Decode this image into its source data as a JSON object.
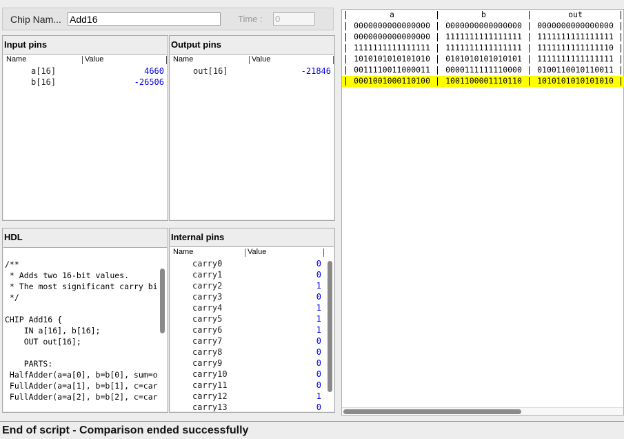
{
  "chip_bar": {
    "chip_label": "Chip Nam...",
    "chip_name": "Add16",
    "time_label": "Time :",
    "time_value": "0"
  },
  "input_pins": {
    "title": "Input pins",
    "col_name": "Name",
    "col_value": "Value",
    "rows": [
      {
        "name": "a[16]",
        "value": "4660"
      },
      {
        "name": "b[16]",
        "value": "-26506"
      }
    ]
  },
  "output_pins": {
    "title": "Output pins",
    "col_name": "Name",
    "col_value": "Value",
    "rows": [
      {
        "name": "out[16]",
        "value": "-21846"
      }
    ]
  },
  "hdl": {
    "title": "HDL",
    "lines": [
      "/**",
      " * Adds two 16-bit values.",
      " * The most significant carry bi",
      " */",
      "",
      "CHIP Add16 {",
      "    IN a[16], b[16];",
      "    OUT out[16];",
      "",
      "    PARTS:",
      " HalfAdder(a=a[0], b=b[0], sum=o",
      " FullAdder(a=a[1], b=b[1], c=car",
      " FullAdder(a=a[2], b=b[2], c=car"
    ]
  },
  "internal_pins": {
    "title": "Internal pins",
    "col_name": "Name",
    "col_value": "Value",
    "rows": [
      {
        "name": "carry0",
        "value": "0"
      },
      {
        "name": "carry1",
        "value": "0"
      },
      {
        "name": "carry2",
        "value": "1"
      },
      {
        "name": "carry3",
        "value": "0"
      },
      {
        "name": "carry4",
        "value": "1"
      },
      {
        "name": "carry5",
        "value": "1"
      },
      {
        "name": "carry6",
        "value": "1"
      },
      {
        "name": "carry7",
        "value": "0"
      },
      {
        "name": "carry8",
        "value": "0"
      },
      {
        "name": "carry9",
        "value": "0"
      },
      {
        "name": "carry10",
        "value": "0"
      },
      {
        "name": "carry11",
        "value": "0"
      },
      {
        "name": "carry12",
        "value": "1"
      },
      {
        "name": "carry13",
        "value": "0"
      }
    ]
  },
  "compare": {
    "headers": [
      "a",
      "b",
      "out"
    ],
    "rows": [
      [
        "0000000000000000",
        "0000000000000000",
        "0000000000000000"
      ],
      [
        "0000000000000000",
        "1111111111111111",
        "1111111111111111"
      ],
      [
        "1111111111111111",
        "1111111111111111",
        "1111111111111110"
      ],
      [
        "1010101010101010",
        "0101010101010101",
        "1111111111111111"
      ],
      [
        "0011110011000011",
        "0000111111110000",
        "0100110010110011"
      ],
      [
        "0001001000110100",
        "1001100001110110",
        "1010101010101010"
      ]
    ],
    "highlight_row": 5,
    "highlight_color": "#ffff00"
  },
  "status": {
    "text": "End of script - Comparison ended successfully"
  },
  "colors": {
    "value_text": "#0000ee",
    "background": "#ededed"
  }
}
